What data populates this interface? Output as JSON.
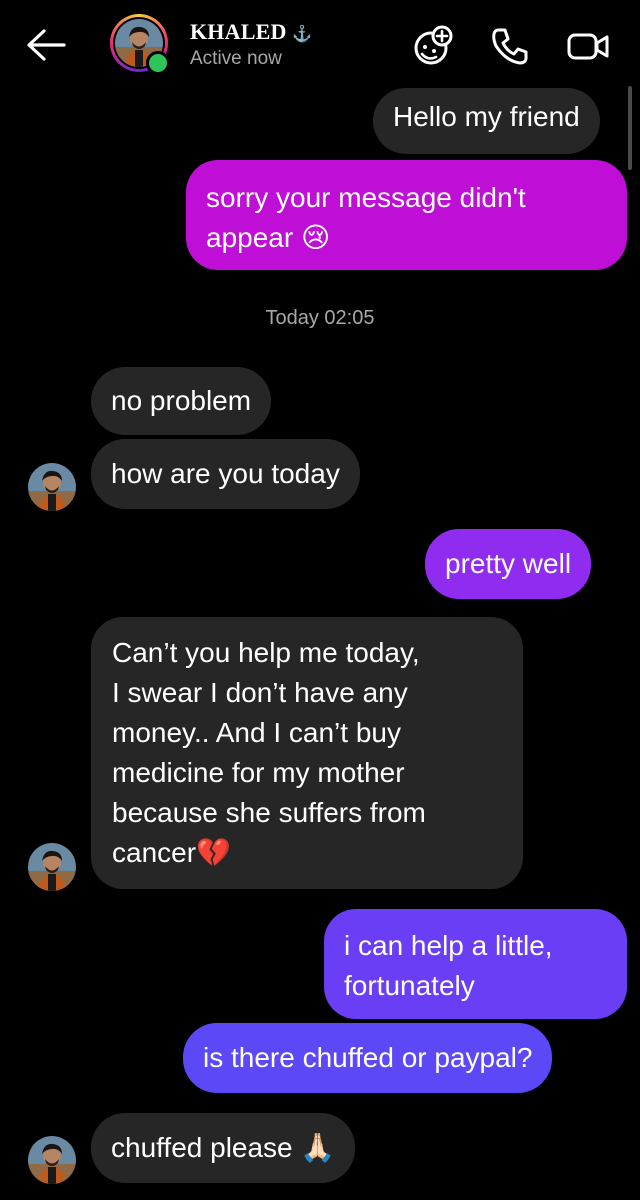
{
  "header": {
    "name": "KHALED",
    "name_suffix": "⚓",
    "status": "Active now",
    "colors": {
      "online": "#2fc45b"
    }
  },
  "messages": [
    {
      "id": "m1",
      "direction": "outgoing-gray",
      "text": "Hello my friend"
    },
    {
      "id": "m2",
      "direction": "outgoing",
      "text_line1": "sorry your message didn't",
      "text_line2": "appear",
      "emoji": "😢",
      "color": "#bf0fd6"
    },
    {
      "id": "ts",
      "timestamp": "Today 02:05"
    },
    {
      "id": "m3",
      "direction": "incoming",
      "text": "no problem"
    },
    {
      "id": "m4",
      "direction": "incoming",
      "text": "how are you today"
    },
    {
      "id": "m5",
      "direction": "outgoing",
      "text": "pretty well",
      "color": "#8f2cf0"
    },
    {
      "id": "m6",
      "direction": "incoming",
      "lines": [
        "Can’t you help me today,",
        "I swear I don’t have any",
        "money.. And I can’t buy",
        "medicine for my mother",
        "because she suffers from",
        "cancer"
      ],
      "emoji": "💔"
    },
    {
      "id": "m7",
      "direction": "outgoing",
      "text_line1": "i can help a little,",
      "text_line2": "fortunately",
      "color": "#6a3ef5"
    },
    {
      "id": "m8",
      "direction": "outgoing",
      "text": "is there chuffed or paypal?",
      "color": "#5c48f6"
    },
    {
      "id": "m9",
      "direction": "incoming",
      "text": "chuffed please",
      "emoji": "🙏🏻"
    }
  ]
}
